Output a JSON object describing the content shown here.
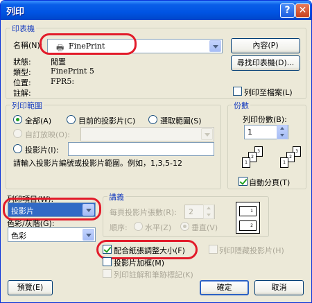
{
  "window": {
    "title": "列印"
  },
  "printer": {
    "group_title": "印表機",
    "name_label": "名稱(N):",
    "name_value": "FinePrint",
    "properties_button": "內容(P)",
    "find_printer_button": "尋找印表機(D)...",
    "status_label": "狀態:",
    "status_value": "閒置",
    "type_label": "類型:",
    "type_value": "FinePrint 5",
    "where_label": "位置:",
    "where_value": "FPR5:",
    "comment_label": "註解:",
    "print_to_file": "列印至檔案(L)"
  },
  "print_range": {
    "group_title": "列印範圍",
    "all": "全部(A)",
    "current_slide": "目前的投影片(C)",
    "selection": "選取範圍(S)",
    "custom_show": "自訂放映(O):",
    "slides": "投影片(I):",
    "hint": "請輸入投影片編號或投影片範圍。例如，1,3,5-12"
  },
  "copies": {
    "group_title": "份數",
    "number_label": "列印份數(B):",
    "number_value": "1",
    "collate": "自動分頁(T)"
  },
  "print_what": {
    "label": "列印項目(W):",
    "value": "投影片"
  },
  "color": {
    "label": "色彩/灰階(G):",
    "value": "色彩"
  },
  "handouts": {
    "group_title": "講義",
    "per_page_label": "每頁投影片張數(R):",
    "per_page_value": "2",
    "order_label": "順序:",
    "horizontal": "水平(Z)",
    "vertical": "垂直(V)"
  },
  "options": {
    "scale_to_fit": "配合紙張調整大小(F)",
    "frame_slides": "投影片加框(M)",
    "print_comments": "列印註解和筆跡標記(K)",
    "print_hidden": "列印隱藏投影片(H)"
  },
  "buttons": {
    "preview": "預覽(E)",
    "ok": "確定",
    "cancel": "取消"
  },
  "thumbnail": {
    "page1": "1",
    "page2": "2"
  },
  "collate_pages": [
    "1",
    "2",
    "3"
  ]
}
